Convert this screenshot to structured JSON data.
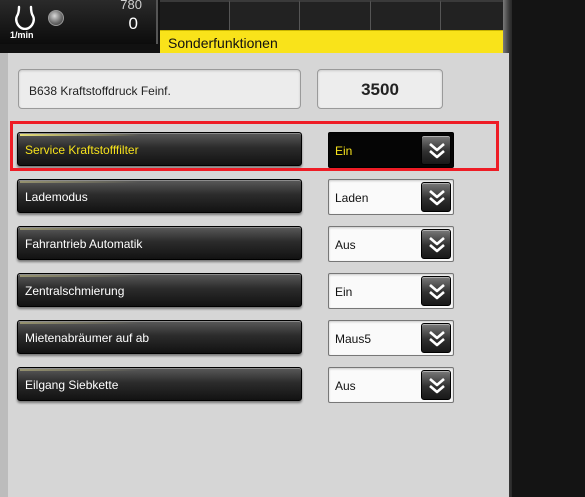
{
  "header": {
    "rpm_unit": "1/min",
    "rpm_top": "780",
    "rpm_value": "0",
    "section_title": "Sonderfunktionen"
  },
  "info": {
    "label": "B638 Kraftstoffdruck Feinf.",
    "value": "3500"
  },
  "settings": [
    {
      "label": "Service Kraftstofffilter",
      "value": "Ein",
      "selected": true
    },
    {
      "label": "Lademodus",
      "value": "Laden"
    },
    {
      "label": "Fahrantrieb Automatik",
      "value": "Aus"
    },
    {
      "label": "Zentralschmierung",
      "value": "Ein"
    },
    {
      "label": "Mietenabräumer auf ab",
      "value": "Maus5"
    },
    {
      "label": "Eilgang Siebkette",
      "value": "Aus"
    }
  ],
  "icons": {
    "engine": "engine-icon",
    "lamp": "indicator-lamp-icon",
    "dropdown": "chevron-double-down-icon"
  },
  "colors": {
    "title_bar": "#f9e31a",
    "selected_text": "#f6e21c",
    "highlight_frame": "#ee1c25"
  }
}
